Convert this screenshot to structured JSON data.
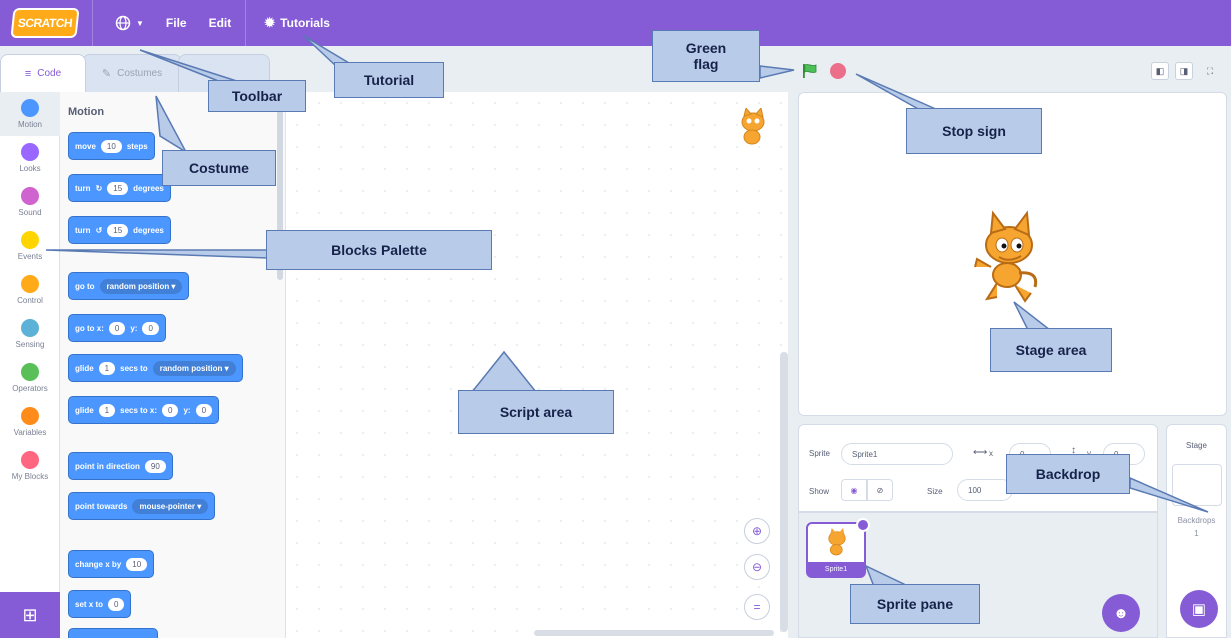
{
  "menubar": {
    "logo": "SCRATCH",
    "language_icon": "globe-icon",
    "file": "File",
    "edit": "Edit",
    "tutorials": "Tutorials"
  },
  "tabs": {
    "code": "Code",
    "costumes": "Costumes"
  },
  "categories": [
    {
      "label": "Motion",
      "color": "#4c97ff"
    },
    {
      "label": "Looks",
      "color": "#9966ff"
    },
    {
      "label": "Sound",
      "color": "#cf63cf"
    },
    {
      "label": "Events",
      "color": "#ffd500"
    },
    {
      "label": "Control",
      "color": "#ffab19"
    },
    {
      "label": "Sensing",
      "color": "#5cb1d6"
    },
    {
      "label": "Operators",
      "color": "#59c059"
    },
    {
      "label": "Variables",
      "color": "#ff8c1a"
    },
    {
      "label": "My Blocks",
      "color": "#ff6680"
    }
  ],
  "palette": {
    "title": "Motion",
    "move": {
      "a": "move",
      "v": "10",
      "b": "steps"
    },
    "turn_right": {
      "a": "turn",
      "v": "15",
      "b": "degrees"
    },
    "turn_left": {
      "a": "turn",
      "v": "15",
      "b": "degrees"
    },
    "goto": {
      "a": "go to",
      "dd": "random position ▾"
    },
    "gotoxy": {
      "a": "go to x:",
      "x": "0",
      "b": "y:",
      "y": "0"
    },
    "glide": {
      "a": "glide",
      "v": "1",
      "b": "secs to",
      "dd": "random position ▾"
    },
    "glidexy": {
      "a": "glide",
      "v": "1",
      "b": "secs to x:",
      "x": "0",
      "c": "y:",
      "y": "0"
    },
    "point_dir": {
      "a": "point in direction",
      "v": "90"
    },
    "point_towards": {
      "a": "point towards",
      "dd": "mouse-pointer ▾"
    },
    "changex": {
      "a": "change x by",
      "v": "10"
    },
    "setx": {
      "a": "set x to",
      "v": "0"
    }
  },
  "sprite_info": {
    "sprite_label": "Sprite",
    "sprite_name": "Sprite1",
    "x_label": "x",
    "x_value": "0",
    "y_label": "y",
    "y_value": "0",
    "show_label": "Show",
    "size_label": "Size",
    "size_value": "100"
  },
  "sprites": [
    {
      "name": "Sprite1"
    }
  ],
  "stage_panel": {
    "title": "Stage",
    "backdrops_label": "Backdrops",
    "backdrops_count": "1"
  },
  "callouts": {
    "toolbar": "Toolbar",
    "tutorial": "Tutorial",
    "green_flag": "Green\nflag",
    "costume": "Costume",
    "stop_sign": "Stop sign",
    "blocks_palette": "Blocks Palette",
    "stage_area": "Stage area",
    "script_area": "Script area",
    "backdrop": "Backdrop",
    "sprite_pane": "Sprite pane"
  },
  "colors": {
    "menubar": "#855cd6",
    "motion": "#4c97ff",
    "callout_fill": "#b8cbe8",
    "callout_border": "#5a7ab3"
  }
}
